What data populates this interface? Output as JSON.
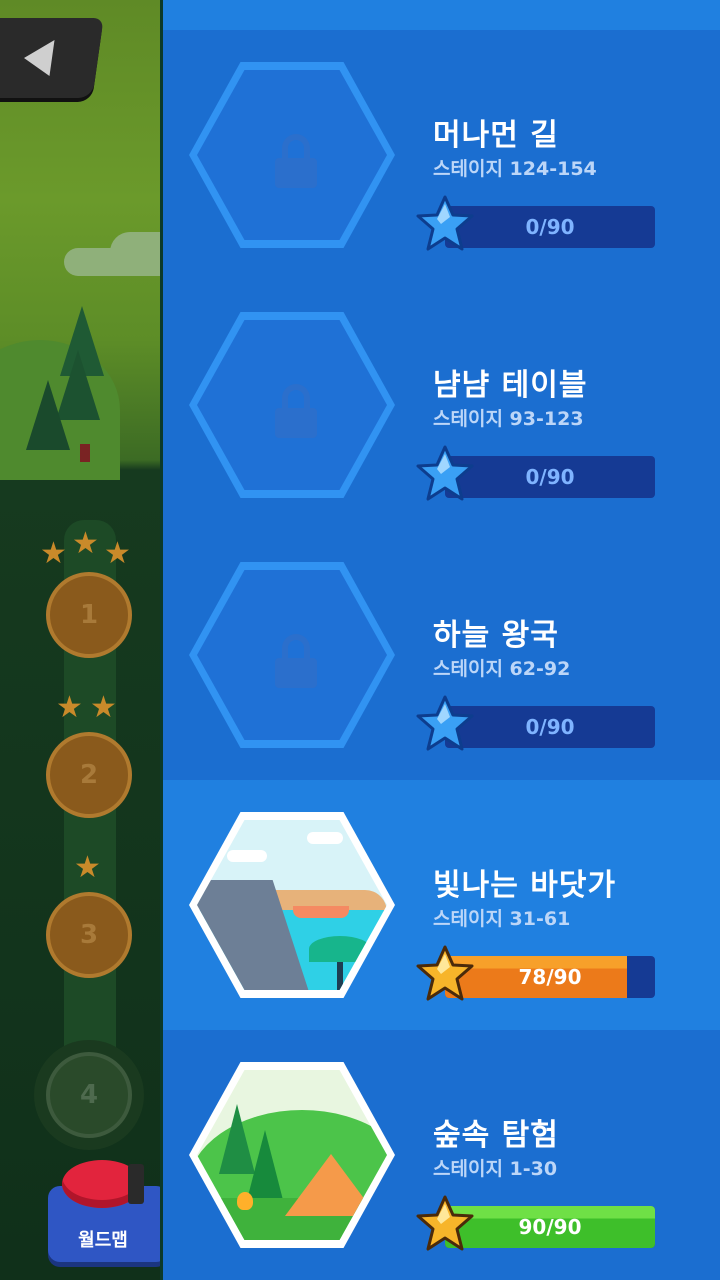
{
  "worldmap_button": {
    "label": "월드맵"
  },
  "map_nodes": [
    {
      "number": "1",
      "stars": 3
    },
    {
      "number": "2",
      "stars": 2
    },
    {
      "number": "3",
      "stars": 1
    },
    {
      "number": "4",
      "stars": 0
    }
  ],
  "stage_prefix": "스테이지",
  "worlds": [
    {
      "title": "머나먼 길",
      "range": "124-154",
      "progress": "0/90",
      "stars_earned": 0,
      "stars_total": 90,
      "locked": true
    },
    {
      "title": "냠냠 테이블",
      "range": "93-123",
      "progress": "0/90",
      "stars_earned": 0,
      "stars_total": 90,
      "locked": true
    },
    {
      "title": "하늘 왕국",
      "range": "62-92",
      "progress": "0/90",
      "stars_earned": 0,
      "stars_total": 90,
      "locked": true
    },
    {
      "title": "빛나는 바닷가",
      "range": "31-61",
      "progress": "78/90",
      "stars_earned": 78,
      "stars_total": 90,
      "locked": false
    },
    {
      "title": "숲속 탐험",
      "range": "1-30",
      "progress": "90/90",
      "stars_earned": 90,
      "stars_total": 90,
      "locked": false
    }
  ],
  "colors": {
    "panel_blue": "#1d73d6",
    "bar_empty": "#153a94",
    "bar_partial": "#ec7a1a",
    "bar_complete": "#3ebf2a",
    "star_blue": "#3aa0f5",
    "star_gold": "#f7b52a"
  }
}
